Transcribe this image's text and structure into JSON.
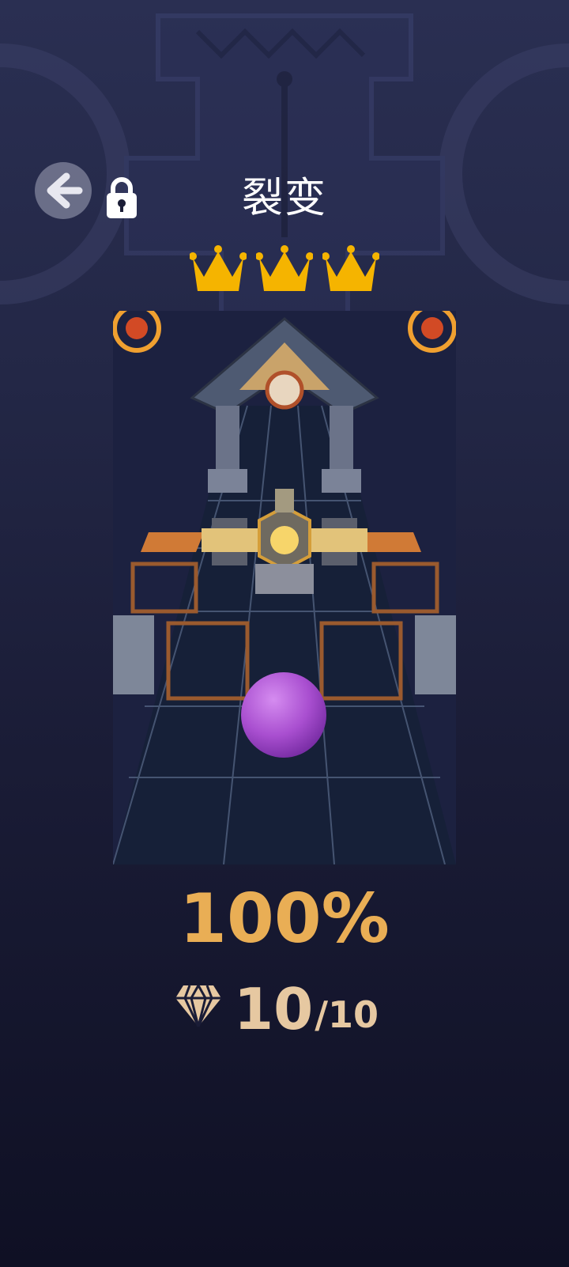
{
  "level": {
    "title": "裂变",
    "crowns_earned": 3,
    "crowns_total": 3,
    "crown_color": "#f5b400",
    "locked": true
  },
  "icons": {
    "back": "back-arrow-icon",
    "lock": "lock-icon",
    "crown": "crown-icon",
    "gem": "diamond-icon"
  },
  "progress": {
    "percent_text": "100%",
    "percent_value": 100
  },
  "gems": {
    "collected": "10",
    "total": "/10"
  },
  "colors": {
    "progress": "#e9ae55",
    "gems": "#e6c8a1",
    "ball": "#a94fd0",
    "accent_orange": "#d07a36"
  }
}
